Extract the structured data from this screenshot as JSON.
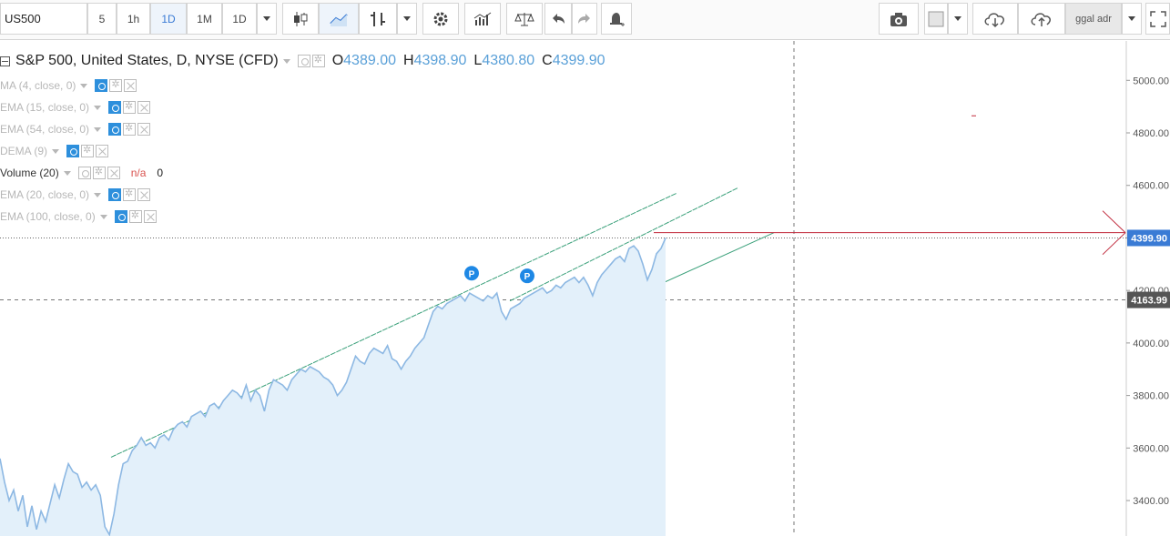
{
  "toolbar": {
    "symbol": "US500",
    "intervals": [
      "5",
      "1h",
      "1D",
      "1M",
      "1D"
    ],
    "active_interval_index": 2,
    "user_label": "ggal adr",
    "icons": [
      "candles-icon",
      "line-chart-icon",
      "bar-chart-icon",
      "settings-gear-icon",
      "indicators-icon",
      "compare-scale-icon",
      "undo-icon",
      "redo-icon",
      "alert-bell-icon",
      "camera-icon",
      "color-box-icon",
      "cloud-download-icon",
      "cloud-upload-icon",
      "fullscreen-icon"
    ]
  },
  "legend": {
    "title": "S&P 500, United States, D, NYSE (CFD)",
    "open_label": "O",
    "open": "4389.00",
    "high_label": "H",
    "high": "4398.90",
    "low_label": "L",
    "low": "4380.80",
    "close_label": "C",
    "close": "4399.90",
    "indicators": [
      {
        "label": "MA (4, close, 0)",
        "dark": false
      },
      {
        "label": "EMA (15, close, 0)",
        "dark": false
      },
      {
        "label": "EMA (54, close, 0)",
        "dark": false
      },
      {
        "label": "DEMA (9)",
        "dark": false
      },
      {
        "label": "Volume (20)",
        "dark": true,
        "value_na": "n/a",
        "value": "0"
      },
      {
        "label": "EMA (20, close, 0)",
        "dark": false
      },
      {
        "label": "EMA (100, close, 0)",
        "dark": false
      }
    ]
  },
  "chart_data": {
    "type": "area",
    "y_ticks": [
      "5000.00",
      "4800.00",
      "4600.00",
      "4400.00",
      "4200.00",
      "4000.00",
      "3800.00",
      "3600.00",
      "3400.00"
    ],
    "y_tick_values": [
      5000,
      4800,
      4600,
      4400,
      4200,
      4000,
      3800,
      3600,
      3400
    ],
    "ylim": [
      3265,
      5150
    ],
    "last_price_label": "4399.90",
    "last_price": 4399.9,
    "crosshair_price_label": "4163.99",
    "crosshair_price": 4163.99,
    "series": [
      {
        "values": [
          3560,
          3470,
          3400,
          3440,
          3360,
          3420,
          3300,
          3380,
          3290,
          3360,
          3320,
          3390,
          3460,
          3410,
          3480,
          3540,
          3510,
          3500,
          3450,
          3470,
          3440,
          3460,
          3420,
          3300,
          3270,
          3350,
          3460,
          3540,
          3550,
          3590,
          3610,
          3640,
          3610,
          3620,
          3600,
          3640,
          3650,
          3630,
          3670,
          3690,
          3700,
          3680,
          3720,
          3730,
          3740,
          3720,
          3760,
          3770,
          3750,
          3780,
          3800,
          3820,
          3810,
          3790,
          3840,
          3780,
          3820,
          3800,
          3740,
          3820,
          3860,
          3850,
          3840,
          3820,
          3860,
          3880,
          3900,
          3890,
          3910,
          3900,
          3890,
          3870,
          3860,
          3840,
          3800,
          3820,
          3850,
          3900,
          3950,
          3930,
          3920,
          3960,
          3980,
          3970,
          3960,
          3990,
          3940,
          3930,
          3900,
          3930,
          3950,
          3980,
          4000,
          4020,
          4070,
          4120,
          4140,
          4130,
          4150,
          4160,
          4170,
          4180,
          4160,
          4190,
          4180,
          4170,
          4160,
          4180,
          4170,
          4190,
          4120,
          4090,
          4130,
          4140,
          4150,
          4170,
          4180,
          4190,
          4200,
          4210,
          4190,
          4200,
          4220,
          4210,
          4230,
          4240,
          4250,
          4230,
          4250,
          4220,
          4180,
          4230,
          4260,
          4280,
          4300,
          4320,
          4330,
          4310,
          4360,
          4370,
          4350,
          4300,
          4240,
          4280,
          4340,
          4360,
          4399.9
        ],
        "markers": [
          {
            "label": "P",
            "price": 4210
          },
          {
            "label": "P",
            "price": 4200
          }
        ]
      }
    ],
    "channel_lines": [
      {
        "from": 3565,
        "to": 4570
      },
      {
        "from": 3290,
        "to": 4420
      },
      {
        "from": 4160,
        "to": 4590
      }
    ],
    "colors": {
      "line": "#8db8e3",
      "fill": "#e3f0fa",
      "channel": "#3aa07a",
      "arrow": "#c0283a",
      "axis_badge": "#3a7bd5",
      "cross_badge": "#555555"
    }
  }
}
